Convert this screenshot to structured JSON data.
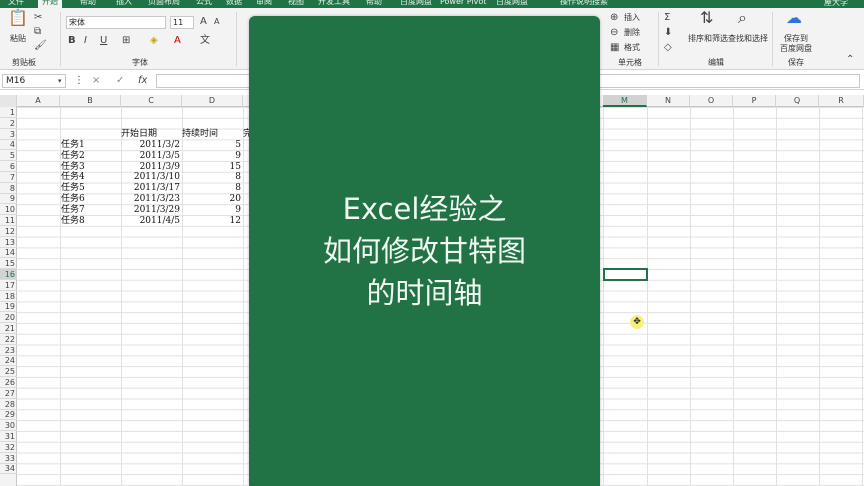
{
  "tabs": [
    "文件",
    "开始",
    "帮助",
    "插入",
    "页面布局",
    "公式",
    "数据",
    "审阅",
    "视图",
    "开发工具",
    "帮助",
    "百度网盘",
    "Power Pivot",
    "百度网盘",
    "操作说明搜索"
  ],
  "active_tab": "开始",
  "user": "屋大学",
  "ribbon": {
    "clipboard": {
      "paste": "粘贴",
      "label": "剪贴板"
    },
    "font": {
      "family": "宋体",
      "size": "11",
      "bold": "B",
      "italic": "I",
      "underline": "U",
      "label": "字体"
    },
    "cells": {
      "insert": "插入",
      "delete": "删除",
      "format": "格式",
      "label": "单元格"
    },
    "editing": {
      "sort_filter": "排序和筛选",
      "find_select": "查找和选择",
      "sum": "Σ",
      "label": "编辑"
    },
    "save": {
      "save_to": "保存到",
      "baidu": "百度网盘",
      "label": "保存"
    }
  },
  "formula_bar": {
    "name_box": "M16",
    "cancel": "×",
    "enter": "✓",
    "fx": "fx",
    "value": ""
  },
  "columns": [
    "A",
    "B",
    "C",
    "D",
    "M",
    "N",
    "O",
    "P",
    "Q",
    "R"
  ],
  "selected_column": "M",
  "rows": [
    "1",
    "2",
    "3",
    "4",
    "5",
    "6",
    "7",
    "8",
    "9",
    "10",
    "11",
    "12",
    "13",
    "14",
    "15",
    "16",
    "17",
    "18",
    "19",
    "20",
    "21",
    "22",
    "23",
    "24",
    "25",
    "26",
    "27",
    "28",
    "29",
    "30",
    "31",
    "32",
    "33",
    "34"
  ],
  "selected_row": "16",
  "table": {
    "headers": {
      "start_date": "开始日期",
      "duration": "持续时间",
      "partial": "完"
    },
    "rows": [
      {
        "task": "任务1",
        "date": "2011/3/2",
        "dur": "5"
      },
      {
        "task": "任务2",
        "date": "2011/3/5",
        "dur": "9"
      },
      {
        "task": "任务3",
        "date": "2011/3/9",
        "dur": "15"
      },
      {
        "task": "任务4",
        "date": "2011/3/10",
        "dur": "8"
      },
      {
        "task": "任务5",
        "date": "2011/3/17",
        "dur": "8"
      },
      {
        "task": "任务6",
        "date": "2011/3/23",
        "dur": "20"
      },
      {
        "task": "任务7",
        "date": "2011/3/29",
        "dur": "9"
      },
      {
        "task": "任务8",
        "date": "2011/4/5",
        "dur": "12"
      }
    ]
  },
  "overlay": {
    "line1": "Excel经验之",
    "line2": "如何修改甘特图",
    "line3": "的时间轴"
  },
  "cursor_icon": "move-cursor-icon",
  "colors": {
    "excel_green": "#217346",
    "overlay_text": "#f2f8f4"
  }
}
